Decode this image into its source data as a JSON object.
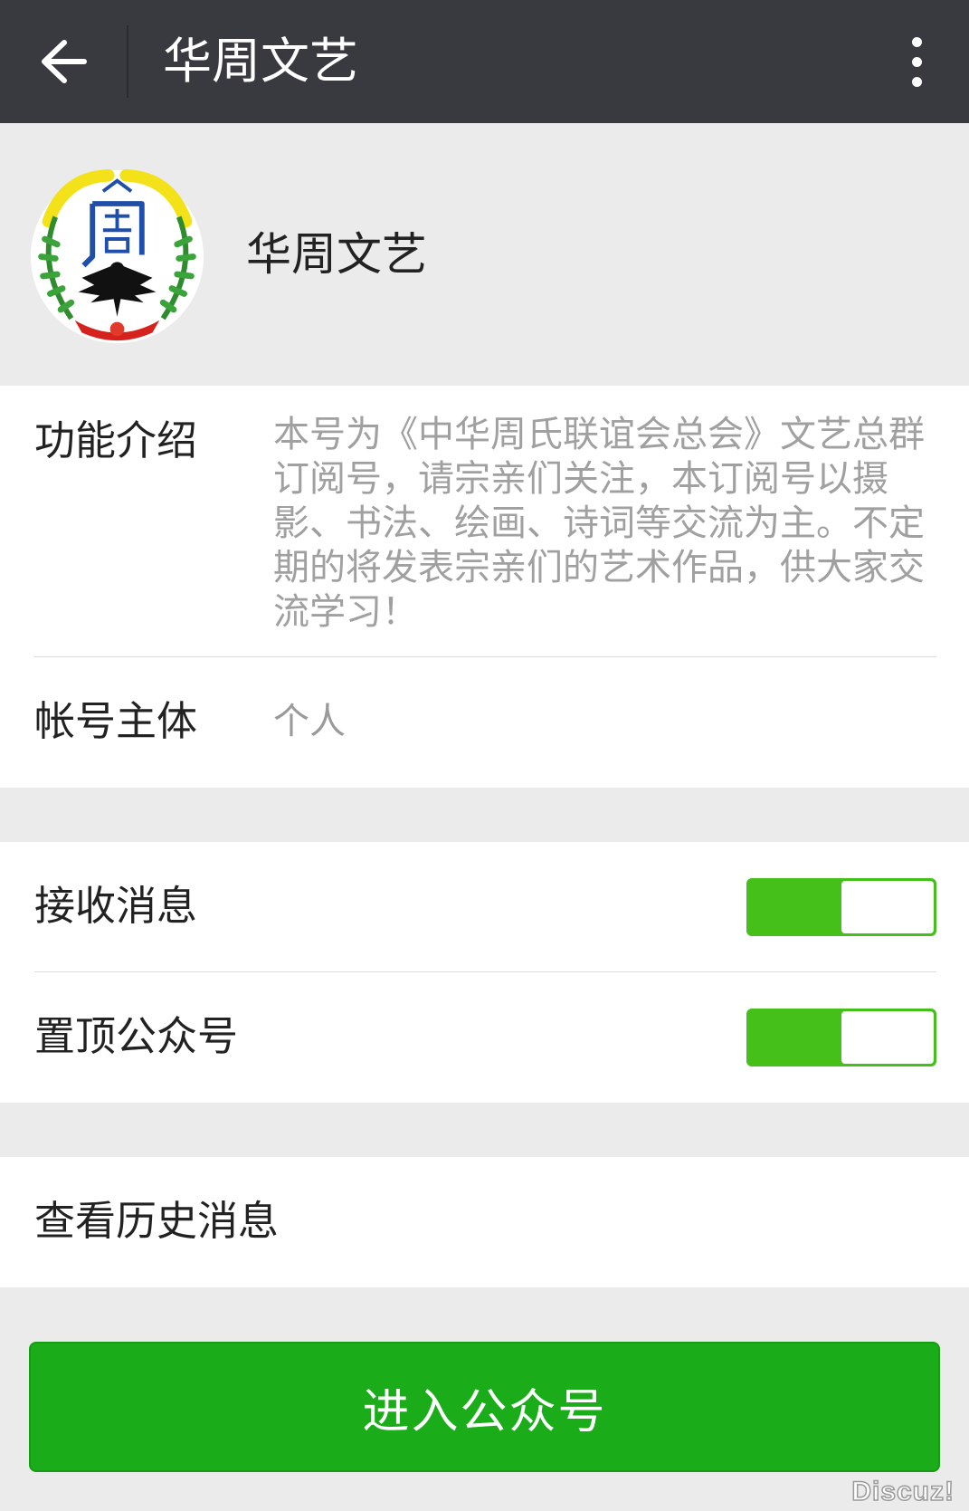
{
  "header": {
    "back_icon": "arrow-left-icon",
    "title": "华周文艺",
    "more_icon": "more-vertical-icon"
  },
  "profile": {
    "name": "华周文艺",
    "avatar": "zhou-clan-emblem"
  },
  "info": {
    "intro_label": "功能介绍",
    "intro_text": "本号为《中华周氏联谊会总会》文艺总群订阅号，请宗亲们关注，本订阅号以摄影、书法、绘画、诗词等交流为主。不定期的将发表宗亲们的艺术作品，供大家交流学习！",
    "owner_label": "帐号主体",
    "owner_value": "个人"
  },
  "settings": {
    "receive_label": "接收消息",
    "receive_on": true,
    "pin_label": "置顶公众号",
    "pin_on": true
  },
  "history": {
    "label": "查看历史消息"
  },
  "enter_button": {
    "label": "进入公众号"
  },
  "colors": {
    "topbar": "#393a3f",
    "accent_green": "#1aad19",
    "toggle_green": "#45c01a",
    "background": "#ebebeb"
  },
  "watermark": "Discuz!"
}
